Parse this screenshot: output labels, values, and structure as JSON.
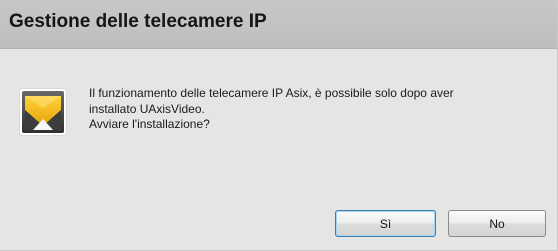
{
  "dialog": {
    "title": "Gestione delle telecamere IP",
    "icon": "app-logo-icon",
    "message_lines": [
      "Il funzionamento delle telecamere IP Asix, è possibile solo dopo aver",
      "installato UAxisVideo.",
      "Avviare l'installazione?"
    ],
    "buttons": {
      "yes_label": "Sì",
      "no_label": "No"
    }
  },
  "colors": {
    "dialog_background": "#e5e5e5",
    "title_bar": "#c4c4c4",
    "icon_yellow": "#f2b817",
    "icon_dark": "#4a4a4a",
    "default_button_border": "#3c7fb1"
  }
}
